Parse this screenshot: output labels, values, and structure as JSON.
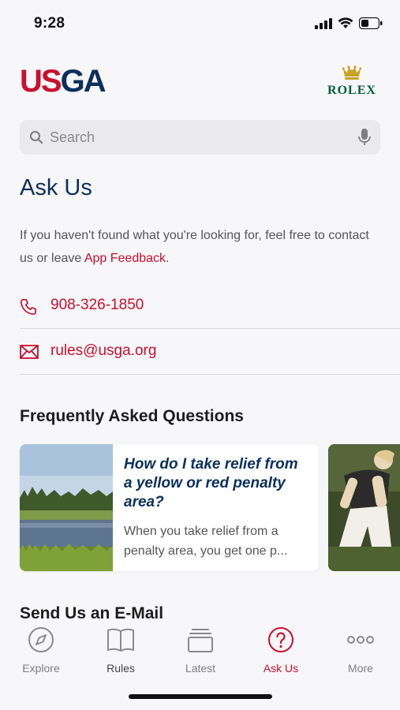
{
  "status": {
    "time": "9:28"
  },
  "brand": {
    "logo_left_us": "US",
    "logo_left_ga": "GA",
    "sponsor": "ROLEX"
  },
  "search": {
    "placeholder": "Search"
  },
  "page": {
    "title": "Ask Us",
    "intro_text": "If you haven't found what you're looking for, feel free to contact us or leave ",
    "intro_link": "App Feedback",
    "intro_end": "."
  },
  "contacts": [
    {
      "icon": "phone-icon",
      "label": "908-326-1850"
    },
    {
      "icon": "mail-icon",
      "label": "rules@usga.org"
    }
  ],
  "faq": {
    "title": "Frequently Asked Questions",
    "cards": [
      {
        "question": "How do I take relief from a yellow or red penalty area?",
        "answer": "When you take relief from a penalty area, you get one p..."
      }
    ]
  },
  "email_section": {
    "title": "Send Us an E-Mail"
  },
  "tabs": [
    {
      "icon": "compass-icon",
      "label": "Explore"
    },
    {
      "icon": "book-icon",
      "label": "Rules"
    },
    {
      "icon": "stack-icon",
      "label": "Latest"
    },
    {
      "icon": "question-icon",
      "label": "Ask Us"
    },
    {
      "icon": "more-icon",
      "label": "More"
    }
  ],
  "colors": {
    "accent": "#c8102e",
    "navy": "#0b2f5c",
    "rolex_green": "#006039"
  }
}
